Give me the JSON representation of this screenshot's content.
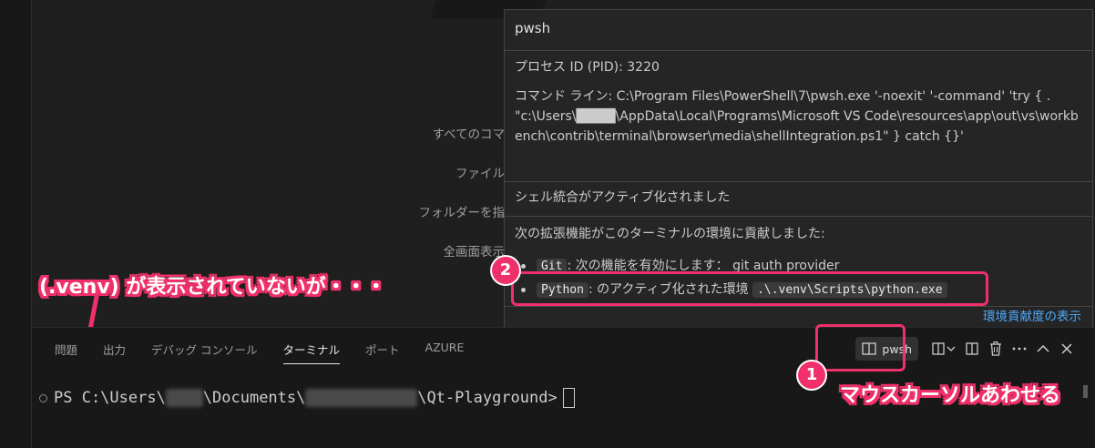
{
  "editor": {
    "hints": [
      "すべてのコマ",
      "ファイル",
      "フォルダーを指",
      "全画面表示"
    ]
  },
  "hover": {
    "title": "pwsh",
    "pid": "プロセス ID (PID): 3220",
    "command_line": "コマンド ライン: C:\\Program Files\\PowerShell\\7\\pwsh.exe '-noexit' '-command' 'try { . \"c:\\Users\\████\\AppData\\Local\\Programs\\Microsoft VS Code\\resources\\app\\out\\vs\\workbench\\contrib\\terminal\\browser\\media\\shellIntegration.ps1\" } catch {}'",
    "shell_integration": "シェル統合がアクティブ化されました",
    "contrib_heading": "次の拡張機能がこのターミナルの環境に貢献しました:",
    "contrib": [
      {
        "name": "Git",
        "text": ": 次の機能を有効にします： git auth provider"
      },
      {
        "name": "Python",
        "text": ": のアクティブ化された環境",
        "code": ".\\.venv\\Scripts\\python.exe"
      }
    ],
    "link": "環境貢献度の表示"
  },
  "annotations": {
    "badge1": "1",
    "badge2": "2",
    "callout_left": "(.venv) が表示されていないが・・・",
    "callout_right": "マウスカーソルあわせる"
  },
  "panel": {
    "tabs": [
      "問題",
      "出力",
      "デバッグ コンソール",
      "ターミナル",
      "ポート",
      "AZURE"
    ],
    "active_tab": "ターミナル",
    "terminal_name": "pwsh"
  },
  "terminal": {
    "prompt_start": "PS C:\\Users\\",
    "user_blur": "████",
    "mid": "\\Documents\\",
    "folder_blur": "████████████",
    "end": "\\Qt-Playground>"
  },
  "colors": {
    "accent_red": "#f0306a",
    "link_blue": "#4daafc",
    "panel_bg": "#181818",
    "hover_bg": "#252526"
  }
}
